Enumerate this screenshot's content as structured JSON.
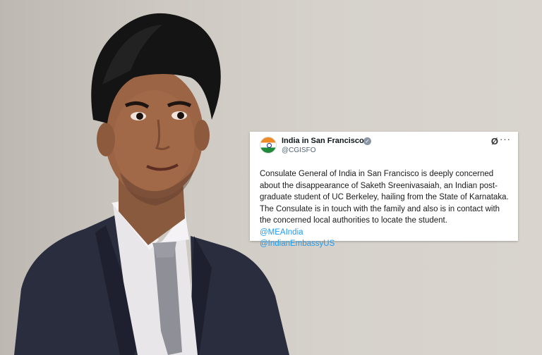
{
  "tweet": {
    "account_name": "India in San Francisco",
    "handle": "@CGISFO",
    "body": "Consulate General of India in San Francisco is deeply concerned about the disappearance of Saketh Sreenivasaiah, an Indian post-graduate student of UC Berkeley, hailing from the State of Karnataka. The Consulate is in touch with the family and also is in contact with the concerned local authorities to locate the student.",
    "mentions": [
      "@MEAIndia",
      "@IndianEmbassyUS"
    ],
    "avatar_icon": "india-flag-icon",
    "verified_icon": "verified-badge-icon",
    "x_icon": "x-logo-icon",
    "more_icon": "more-icon"
  },
  "colors": {
    "mention": "#1d9bf0",
    "suit": "#2a2d3d",
    "background": "#d4d0c9"
  }
}
